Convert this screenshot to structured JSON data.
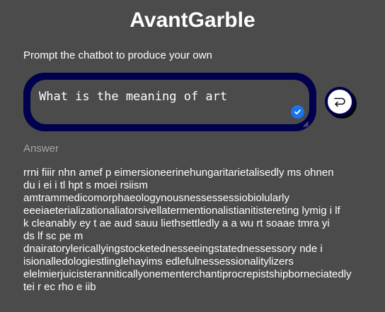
{
  "app": {
    "title": "AvantGarble"
  },
  "prompt": {
    "label": "Prompt the chatbot to produce your own",
    "value": "What is the meaning of art"
  },
  "send_button": {
    "icon": "return-arrow-icon"
  },
  "answer": {
    "label": "Answer",
    "text": "rrni fiiir nhn amef p eimersioneerinehungaritarietalisedly ms ohnen\ndu i ei i tl hpt s moei rsiism\namtrammedicomorphaeologynousnessessessiobiolularly\neeeiaeterializationaliatorsivellatermentionalistianitistereting lymig i lf\nk cleanably ey t ae aud sauu liethsettledly a a wu rt soaae tmra yi\nds lf sc pe m\ndnairatorylericallyingstocketednesseeingstatednessessory nde i\nisionalledologiestlinglehayims edlefulnessessionalitylizers\nelelmierjuicisteranniticallyonementerchantiprocrepistshipborneciatedly\ntei r ec rho e iib"
  },
  "colors": {
    "background": "#4b4b4b",
    "prompt_border": "#00004f",
    "check_badge": "#1a73e8",
    "answer_label": "#a6a6a6"
  }
}
